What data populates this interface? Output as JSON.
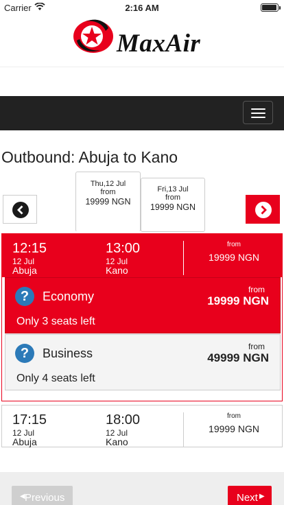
{
  "status_bar": {
    "carrier": "Carrier",
    "time": "2:16 AM",
    "wifi_icon": "wifi-icon",
    "battery_icon": "battery-icon"
  },
  "brand": {
    "name": "MaxAir",
    "accent": "#e8001c",
    "nav_bg": "#222222"
  },
  "nav": {
    "menu_icon": "hamburger-menu-icon"
  },
  "page_title": "Outbound: Abuja to Kano",
  "date_tabs": [
    {
      "day": "Thu,12 Jul",
      "from": "from",
      "price": "19999 NGN",
      "selected": true
    },
    {
      "day": "Fri,13 Jul",
      "from": "from",
      "price": "19999 NGN",
      "selected": false
    }
  ],
  "arrows": {
    "prev_icon": "chevron-left-circle-icon",
    "next_icon": "chevron-right-circle-icon"
  },
  "flights": [
    {
      "depart_time": "12:15",
      "depart_date": "12 Jul",
      "depart_city": "Abuja",
      "arrive_time": "13:00",
      "arrive_date": "12 Jul",
      "arrive_city": "Kano",
      "from": "from",
      "price": "19999 NGN",
      "fares": [
        {
          "name": "Economy",
          "from": "from",
          "price": "19999 NGN",
          "seats": "Only 3 seats left",
          "icon": "question-circle-icon",
          "selected": true
        },
        {
          "name": "Business",
          "from": "from",
          "price": "49999 NGN",
          "seats": "Only 4 seats left",
          "icon": "question-circle-icon",
          "selected": false
        }
      ]
    },
    {
      "depart_time": "17:15",
      "depart_date": "12 Jul",
      "depart_city": "Abuja",
      "arrive_time": "18:00",
      "arrive_date": "12 Jul",
      "arrive_city": "Kano",
      "from": "from",
      "price": "19999 NGN"
    }
  ],
  "buttons": {
    "previous": "Previous",
    "next": "Next"
  }
}
